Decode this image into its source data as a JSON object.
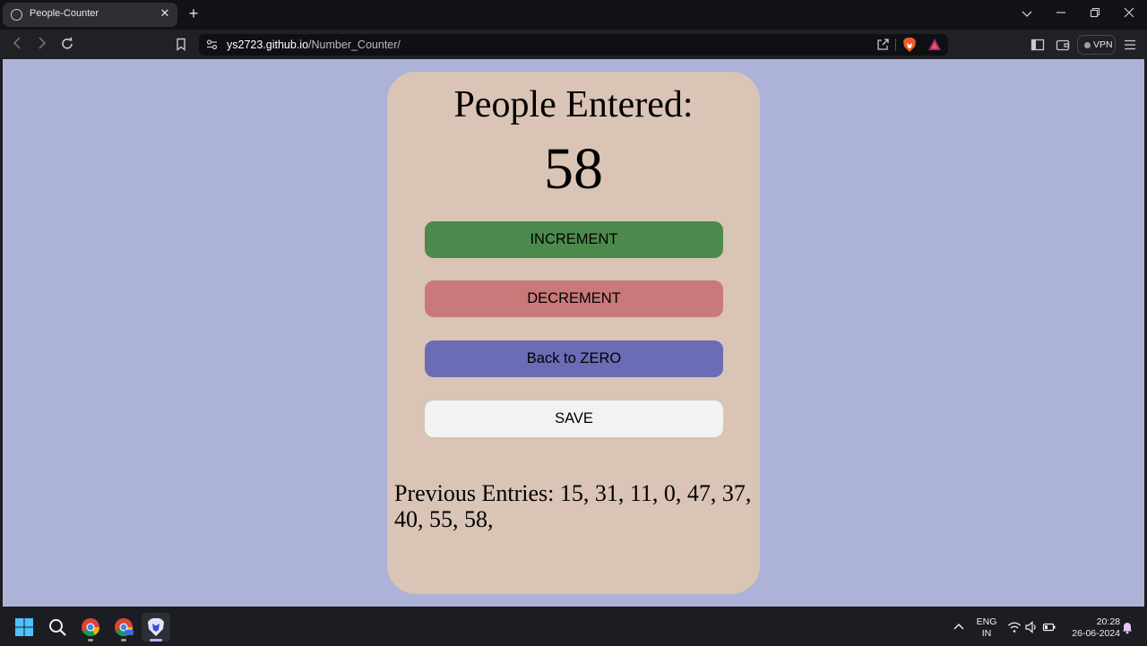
{
  "browser": {
    "tab_title": "People-Counter",
    "tab_close": "✕",
    "new_tab": "+",
    "url_host": "ys2723.github.io",
    "url_path": "/Number_Counter/",
    "vpn_label": "VPN",
    "icons": {
      "back": "chevron-left-icon",
      "forward": "chevron-right-icon",
      "reload": "reload-icon",
      "bookmark": "bookmark-icon",
      "site_settings": "tune-icon",
      "share": "share-icon",
      "brave_shields": "brave-lion-icon",
      "brave_rewards": "rewards-triangle-icon",
      "sidebar": "sidebar-icon",
      "wallet": "wallet-icon",
      "menu": "hamburger-menu-icon"
    }
  },
  "app": {
    "heading": "People Entered:",
    "count": "58",
    "buttons": {
      "increment": "INCREMENT",
      "decrement": "DECREMENT",
      "reset": "Back to ZERO",
      "save": "SAVE"
    },
    "previous_entries": "Previous Entries: 15, 31, 11, 0, 47, 37, 40, 55, 58,",
    "colors": {
      "page_bg": "#acb2d8",
      "card_bg": "#d9c4b5",
      "increment_bg": "#4b8a4c",
      "decrement_bg": "#c97979",
      "reset_bg": "#6b6bb6",
      "save_bg": "#f2f2f2"
    }
  },
  "taskbar": {
    "language": "ENG",
    "region": "IN",
    "time": "20:28",
    "date": "26-06-2024",
    "icons": [
      "windows-start-icon",
      "search-icon",
      "chrome-icon",
      "chrome-beta-icon",
      "brave-browser-icon"
    ]
  }
}
